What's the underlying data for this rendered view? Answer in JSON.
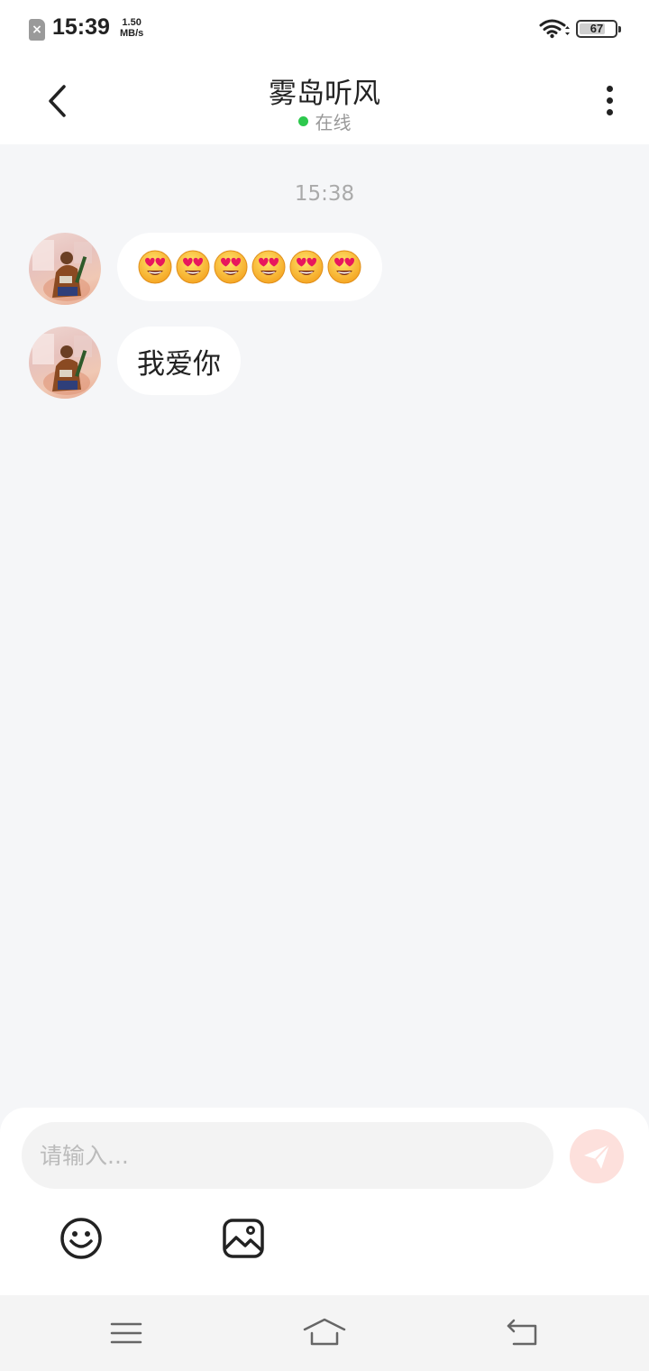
{
  "status_bar": {
    "time": "15:39",
    "net_speed_value": "1.50",
    "net_speed_unit": "MB/s",
    "battery_level": "67"
  },
  "header": {
    "title": "雾岛听风",
    "presence": "在线",
    "presence_color": "#2dc84d"
  },
  "chat": {
    "timestamp": "15:38",
    "messages": [
      {
        "sender": "contact",
        "type": "emoji",
        "content": "😍😍😍😍😍😍",
        "emoji_count": 6,
        "emoji_name": "smiling-face-with-heart-eyes"
      },
      {
        "sender": "contact",
        "type": "text",
        "content": "我爱你"
      }
    ]
  },
  "composer": {
    "placeholder": "请输入...",
    "send_icon": "paper-plane-icon",
    "tools": [
      "smiley-icon",
      "image-icon"
    ]
  },
  "nav_bar": {
    "buttons": [
      "menu-icon",
      "home-icon",
      "back-icon"
    ]
  },
  "colors": {
    "background": "#f5f6f8",
    "bubble": "#ffffff",
    "send_button": "#fde0dc"
  }
}
